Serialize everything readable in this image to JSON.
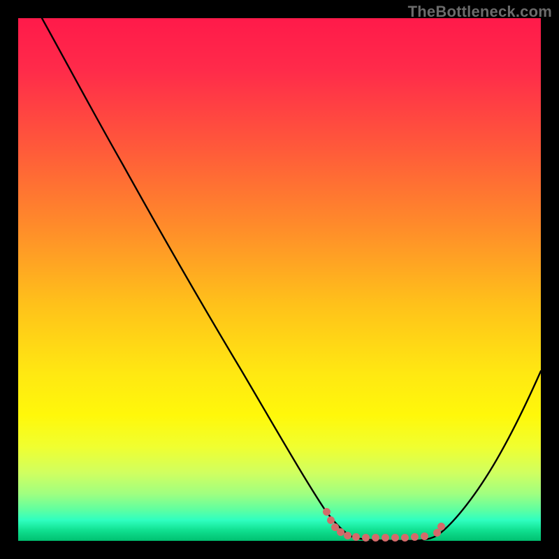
{
  "watermark": "TheBottleneck.com",
  "chart_data": {
    "type": "line",
    "x": [
      0.0,
      0.05,
      0.1,
      0.15,
      0.2,
      0.25,
      0.3,
      0.35,
      0.4,
      0.45,
      0.5,
      0.55,
      0.6,
      0.63,
      0.66,
      0.7,
      0.74,
      0.78,
      0.82,
      0.86,
      0.9,
      0.95,
      1.0
    ],
    "values": [
      100,
      95,
      89,
      82,
      75,
      68,
      60,
      52,
      43,
      34,
      24,
      14,
      6,
      2,
      0,
      0,
      0,
      0,
      2,
      6,
      12,
      22,
      35
    ],
    "title": "",
    "xlabel": "",
    "ylabel": "",
    "xlim": [
      0,
      1
    ],
    "ylim": [
      0,
      100
    ],
    "grid": false,
    "markers": {
      "style": "dot-cluster",
      "color": "#d46a6a",
      "x_range": [
        0.58,
        0.8
      ],
      "y": 0
    },
    "background_gradient": [
      "#ff1a4a",
      "#ff5a3a",
      "#ffc21a",
      "#fff80a",
      "#60ffa0",
      "#00c070"
    ]
  }
}
